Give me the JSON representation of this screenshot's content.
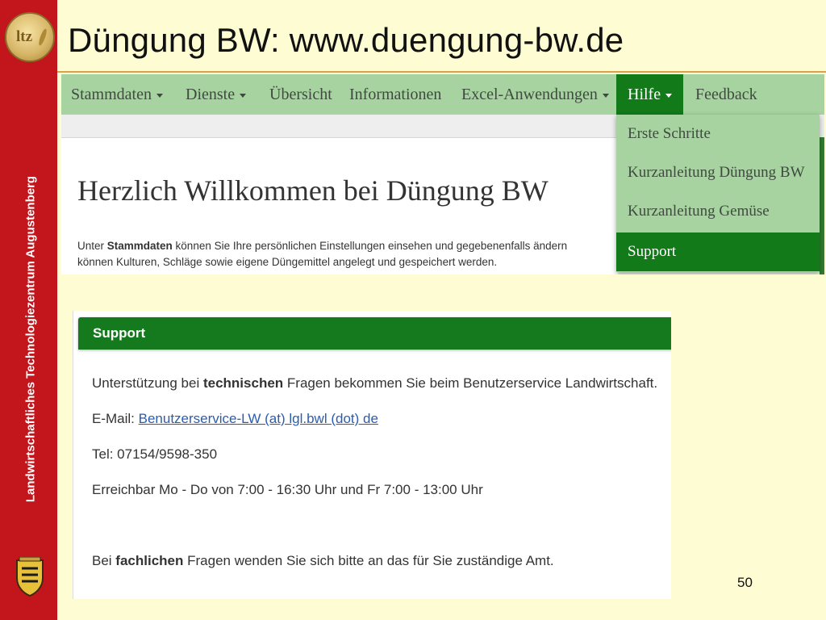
{
  "slide": {
    "title": "Düngung BW: www.duengung-bw.de",
    "side_text": "Landwirtschaftliches Technologiezentrum Augustenberg",
    "logo_text": "ltz",
    "page_number": "50"
  },
  "navbar": {
    "items": [
      {
        "label": "Stammdaten",
        "caret": true
      },
      {
        "label": "Dienste",
        "caret": true
      },
      {
        "label": "Übersicht",
        "caret": false
      },
      {
        "label": "Informationen",
        "caret": false
      },
      {
        "label": "Excel-Anwendungen",
        "caret": true
      },
      {
        "label": "Hilfe",
        "caret": true,
        "active": true
      },
      {
        "label": "Feedback",
        "caret": false
      }
    ]
  },
  "dropdown": {
    "items": [
      {
        "label": "Erste Schritte"
      },
      {
        "label": "Kurzanleitung Düngung BW"
      },
      {
        "label": "Kurzanleitung Gemüse"
      },
      {
        "label": "Support",
        "active": true
      }
    ]
  },
  "welcome": {
    "heading": "Herzlich Willkommen bei Düngung BW",
    "line1_pre": "Unter ",
    "line1_bold": "Stammdaten",
    "line1_post": " können Sie Ihre persönlichen Einstellungen einsehen und gegebenenfalls ändern",
    "line2": "können Kulturen, Schläge sowie eigene Düngemittel angelegt und gespeichert werden."
  },
  "support": {
    "title": "Support",
    "tech_pre": "Unterstützung bei ",
    "tech_bold": "technischen",
    "tech_post": " Fragen bekommen Sie beim Benutzerservice Landwirtschaft.",
    "email_label": "E-Mail: ",
    "email_link": "Benutzerservice-LW (at) lgl.bwl (dot) de",
    "phone": "Tel: 07154/9598-350",
    "hours": "Erreichbar Mo - Do von 7:00 - 16:30 Uhr und Fr 7:00 - 13:00 Uhr",
    "fach_pre": "Bei ",
    "fach_bold": "fachlichen",
    "fach_post": " Fragen wenden Sie sich bitte an das für Sie zuständige Amt."
  },
  "colors": {
    "band_red": "#c2161c",
    "nav_green": "#a7d3a0",
    "active_green": "#137a1a",
    "slide_bg": "#fefcd2"
  }
}
